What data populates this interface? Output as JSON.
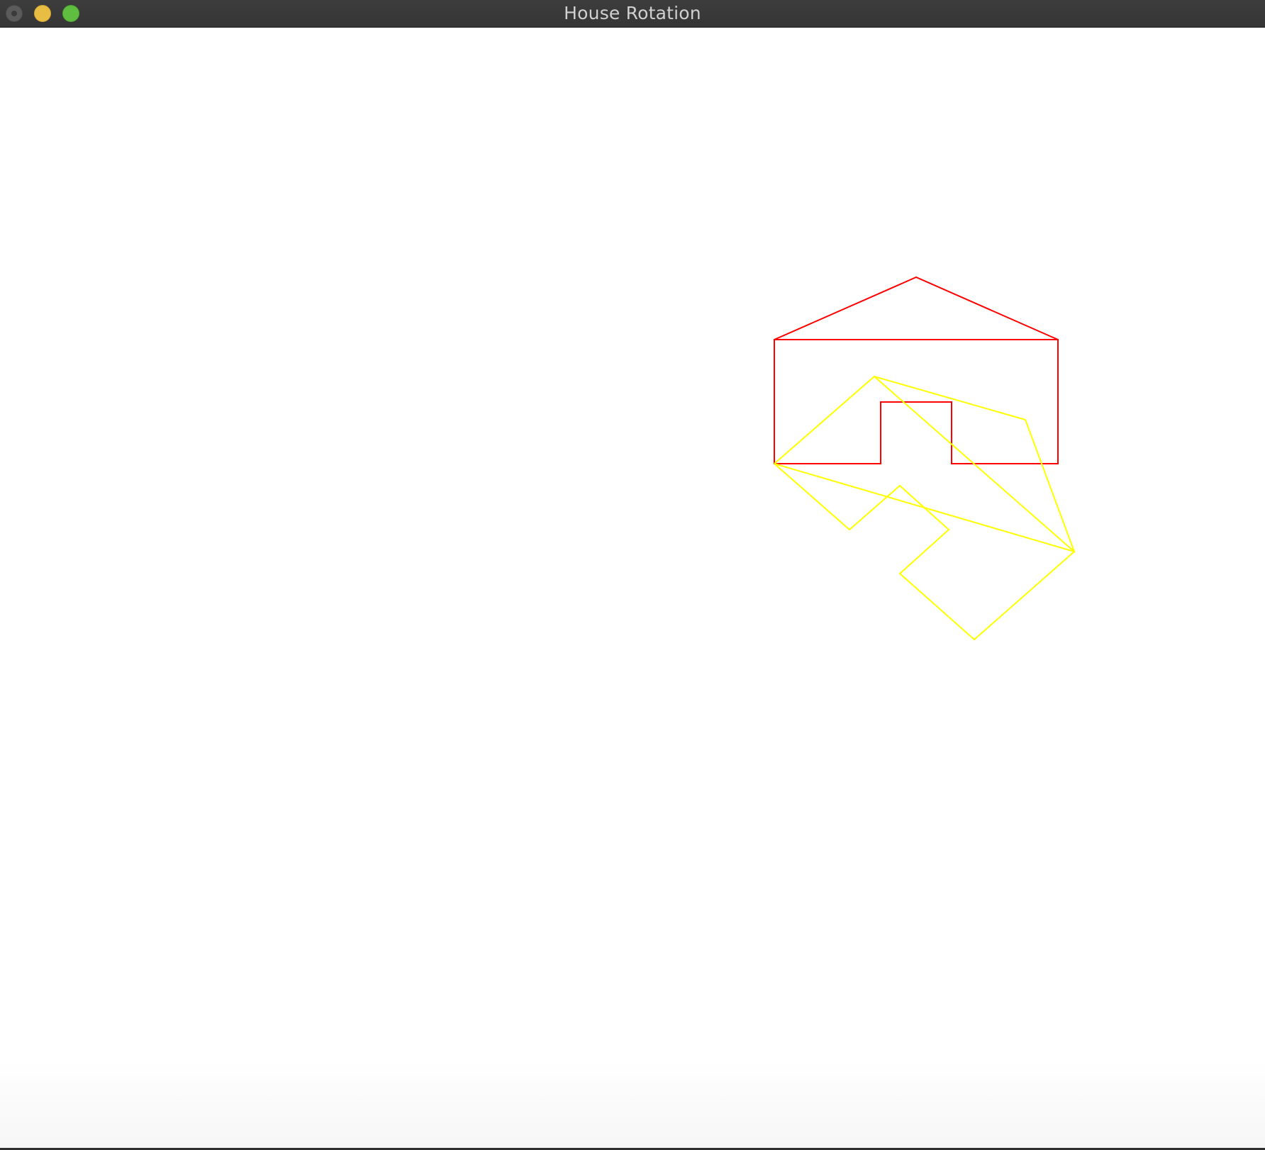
{
  "window": {
    "title": "House Rotation",
    "buttons": {
      "close": "close",
      "minimize": "minimize",
      "zoom": "zoom"
    }
  },
  "drawing": {
    "original_house": {
      "color": "#ff0000"
    },
    "rotated_house": {
      "color": "#ffff00"
    }
  }
}
